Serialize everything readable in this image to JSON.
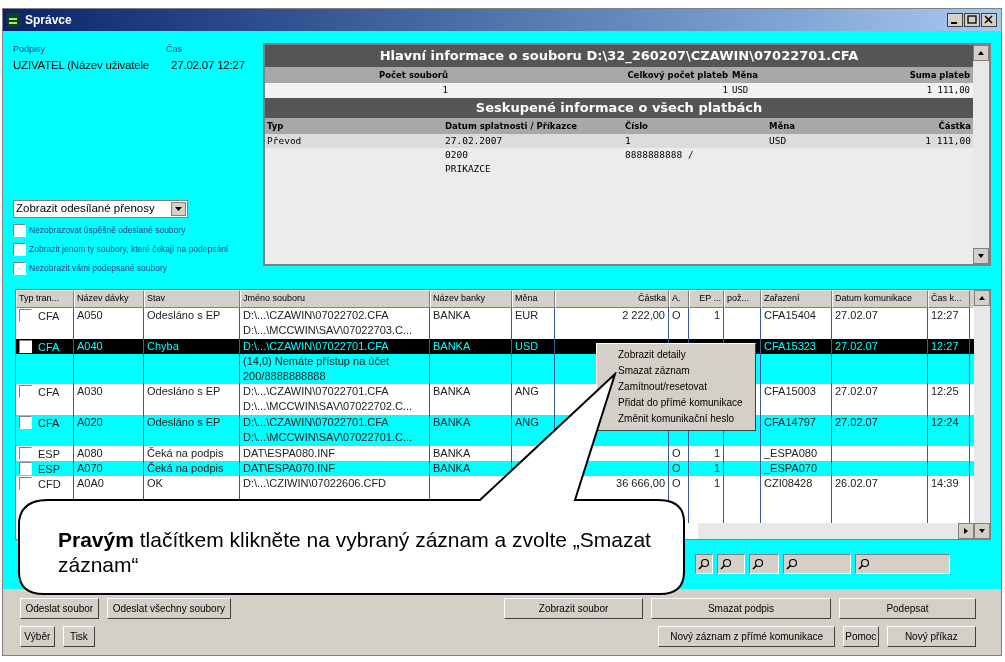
{
  "window": {
    "title": "Správce"
  },
  "signature": {
    "label": "Podpisy",
    "value": "UZIVATEL (Název uživatele",
    "time_label": "Čas",
    "time_value": "27.02.07 12:27"
  },
  "filter_select": {
    "value": "Zobrazit odesílané přenosy"
  },
  "options": [
    {
      "label": "Nezobrazovat úspěšně odeslané soubory",
      "checked": false
    },
    {
      "label": "Zobrazit jenom ty soubory, které čekají na podepsání",
      "checked": false
    },
    {
      "label": "Nezobrazit vámi podepsané soubory",
      "checked": false
    }
  ],
  "file_info": {
    "title": "Hlavní informace o souboru D:\\32_260207\\CZAWIN\\07022701.CFA",
    "columns": [
      "Počet souborů",
      "Celkový počet plateb",
      "Měna",
      "Suma plateb"
    ],
    "values": [
      "1",
      "1",
      "USD",
      "1 111,00"
    ]
  },
  "group_info": {
    "title": "Seskupené informace o všech platbách",
    "columns": [
      "Typ",
      "Datum splatnosti / Příkazce",
      "Číslo",
      "Měna",
      "Částka"
    ],
    "rows": [
      [
        "Převod",
        "27.02.2007",
        "1",
        "USD",
        "1 111,00"
      ],
      [
        "",
        "0200",
        "8888888888 /",
        "",
        ""
      ],
      [
        "",
        "PRIKAZCE",
        "",
        "",
        ""
      ]
    ]
  },
  "table": {
    "columns": [
      "Typ tran...",
      "Název dávky",
      "Stav",
      "Jméno souboru",
      "Název banky",
      "Měna",
      "Částka",
      "A.",
      "EP ...",
      "pož...",
      "Zařazení",
      "Datum komunikace",
      "Čas k..."
    ],
    "rows": [
      {
        "selected": false,
        "checked": false,
        "cells": [
          "CFA",
          "A050",
          "Odesláno s EP",
          [
            "D:\\...\\CZAWIN\\07022702.CFA",
            "D:\\...\\MCCWIN\\SAV\\07022703.C..."
          ],
          "BANKA",
          "EUR",
          "2 222,00",
          "O",
          "1",
          "",
          "CFA15404",
          "27.02.07",
          "12:27"
        ]
      },
      {
        "selected": true,
        "checked": false,
        "cells": [
          "CFA",
          "A040",
          "Chyba",
          [
            "D:\\...\\CZAWIN\\07022701.CFA",
            "(14,0) Nemáte přístup na účet",
            "200/8888888888"
          ],
          "BANKA",
          "USD",
          "",
          "",
          "",
          "",
          "CFA15323",
          "27.02.07",
          "12:27"
        ]
      },
      {
        "selected": false,
        "checked": false,
        "cells": [
          "CFA",
          "A030",
          "Odesláno s EP",
          [
            "D:\\...\\CZAWIN\\07022701.CFA",
            "D:\\...\\MCCWIN\\SAV\\07022702.C..."
          ],
          "BANKA",
          "ANG",
          "",
          "",
          "",
          "",
          "CFA15003",
          "27.02.07",
          "12:25"
        ]
      },
      {
        "selected": false,
        "checked": false,
        "cells": [
          "CFA",
          "A020",
          "Odesláno s EP",
          [
            "D:\\...\\CZAWIN\\07022701.CFA",
            "D:\\...\\MCCWIN\\SAV\\07022701.C..."
          ],
          "BANKA",
          "ANG",
          "",
          "",
          "",
          "",
          "CFA14797",
          "27.02.07",
          "12:24"
        ]
      },
      {
        "selected": false,
        "checked": false,
        "cells": [
          "ESP",
          "A080",
          "Čeká na podpis",
          [
            "DAT\\ESPA080.INF"
          ],
          "BANKA",
          "",
          "",
          "O",
          "1",
          "",
          "_ESPA080",
          "",
          ""
        ]
      },
      {
        "selected": false,
        "checked": false,
        "cells": [
          "ESP",
          "A070",
          "Čeká na podpis",
          [
            "DAT\\ESPA070.INF"
          ],
          "BANKA",
          "",
          "",
          "O",
          "1",
          "",
          "_ESPA070",
          "",
          ""
        ]
      },
      {
        "selected": false,
        "checked": false,
        "cells": [
          "CFD",
          "A0A0",
          "OK",
          [
            "D:\\...\\CZIWIN\\07022606.CFD"
          ],
          "",
          "",
          "36 666,00",
          "O",
          "1",
          "",
          "CZI08428",
          "26.02.07",
          "14:39"
        ]
      }
    ]
  },
  "context_menu": [
    "Zobrazit detaily",
    "Smazat záznam",
    "Zamítnout/resetovat",
    "Přidat do přímé komunikace",
    "Změnit komunikační heslo"
  ],
  "callout": "**Pravým** tlačítkem klikněte na vybraný záznam a zvolte „Smazat záznam“",
  "buttons": [
    {
      "left": [
        "Odeslat soubor",
        "Odeslat všechny soubory"
      ],
      "right": [
        "Zobrazit soubor",
        "Smazat podpis",
        "Podepsat"
      ]
    },
    {
      "left": [
        "Výběr",
        "Tisk"
      ],
      "right": [
        "Nový záznam z přímé komunikace",
        "Pomoc",
        "Nový příkaz"
      ]
    }
  ]
}
